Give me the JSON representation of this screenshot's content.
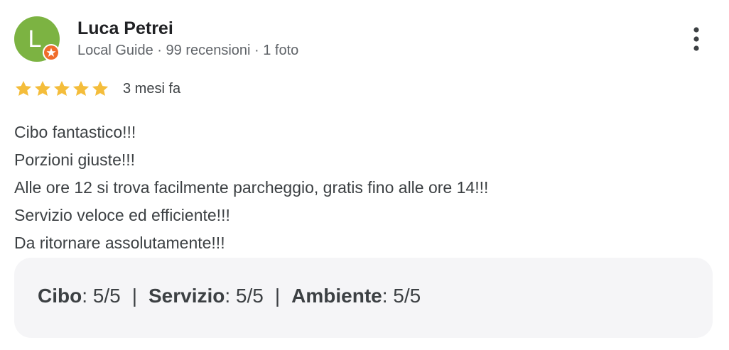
{
  "reviewer": {
    "initial": "L",
    "name": "Luca Petrei",
    "meta": "Local Guide · 99 recensioni · 1 foto",
    "avatar_color": "#7cb342",
    "badge_color": "#f06c2b",
    "badge_icon": "local-guide-star-icon"
  },
  "review": {
    "rating": 5,
    "rating_max": 5,
    "star_color": "#f4bd3b",
    "time": "3 mesi fa",
    "lines": [
      "Cibo fantastico!!!",
      "Porzioni giuste!!!",
      "Alle ore 12 si trova facilmente parcheggio, gratis fino alle ore 14!!!",
      "Servizio veloce ed efficiente!!!",
      "Da ritornare assolutamente!!!"
    ]
  },
  "ratings": [
    {
      "label": "Cibo",
      "value": ": 5/5"
    },
    {
      "label": "Servizio",
      "value": ": 5/5"
    },
    {
      "label": "Ambiente",
      "value": ": 5/5"
    }
  ],
  "separator": "|",
  "menu_icon": "more-vert-icon"
}
